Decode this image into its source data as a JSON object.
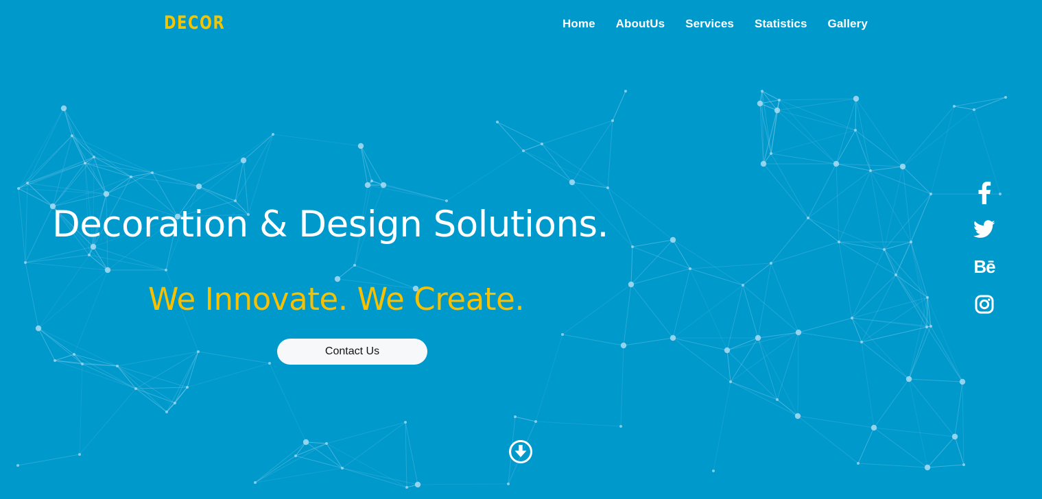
{
  "brand": {
    "name": "DECOR",
    "color": "#f5c400"
  },
  "nav": {
    "items": [
      {
        "label": "Home"
      },
      {
        "label": "AboutUs"
      },
      {
        "label": "Services"
      },
      {
        "label": "Statistics"
      },
      {
        "label": "Gallery"
      }
    ]
  },
  "hero": {
    "title": "Decoration & Design Solutions.",
    "subtitle": "We Innovate. We Create.",
    "subtitle_color": "#f7c000",
    "cta_label": "Contact Us"
  },
  "social": {
    "icons": [
      "facebook-icon",
      "twitter-icon",
      "behance-icon",
      "instagram-icon"
    ],
    "behance_label": "Bē"
  },
  "scroll": {
    "icon": "arrow-down-circle-icon"
  },
  "colors": {
    "background": "#0099cc",
    "foreground": "#ffffff",
    "accent": "#f5c400"
  }
}
